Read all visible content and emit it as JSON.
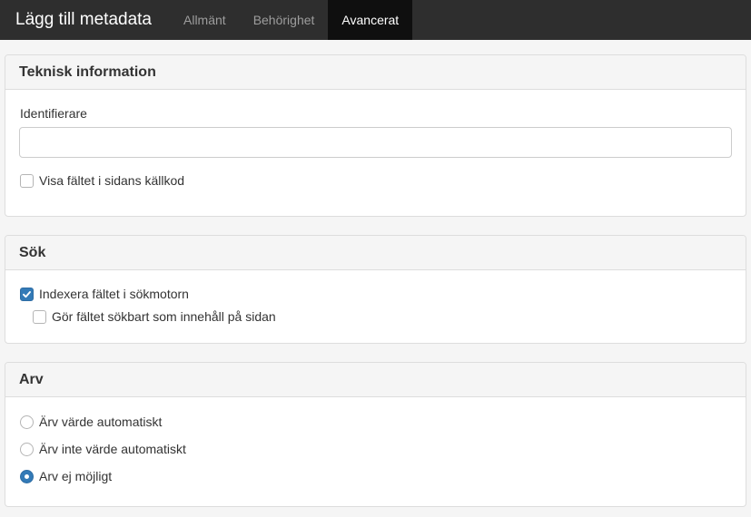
{
  "header": {
    "title": "Lägg till metadata",
    "tabs": [
      {
        "label": "Allmänt",
        "active": false
      },
      {
        "label": "Behörighet",
        "active": false
      },
      {
        "label": "Avancerat",
        "active": true
      }
    ]
  },
  "technical": {
    "heading": "Teknisk information",
    "identifier_label": "Identifierare",
    "identifier_value": "",
    "identifier_placeholder": "",
    "show_in_source": {
      "label": "Visa fältet i sidans källkod",
      "checked": false
    }
  },
  "search": {
    "heading": "Sök",
    "index_field": {
      "label": "Indexera fältet i sökmotorn",
      "checked": true
    },
    "searchable_content": {
      "label": "Gör fältet sökbart som innehåll på sidan",
      "checked": false
    }
  },
  "inheritance": {
    "heading": "Arv",
    "options": [
      {
        "label": "Ärv värde automatiskt",
        "selected": false
      },
      {
        "label": "Ärv inte värde automatiskt",
        "selected": false
      },
      {
        "label": "Arv ej möjligt",
        "selected": true
      }
    ]
  },
  "colors": {
    "topbar": "#2e2e2e",
    "active_tab": "#0f0f0f",
    "accent": "#337ab7"
  }
}
